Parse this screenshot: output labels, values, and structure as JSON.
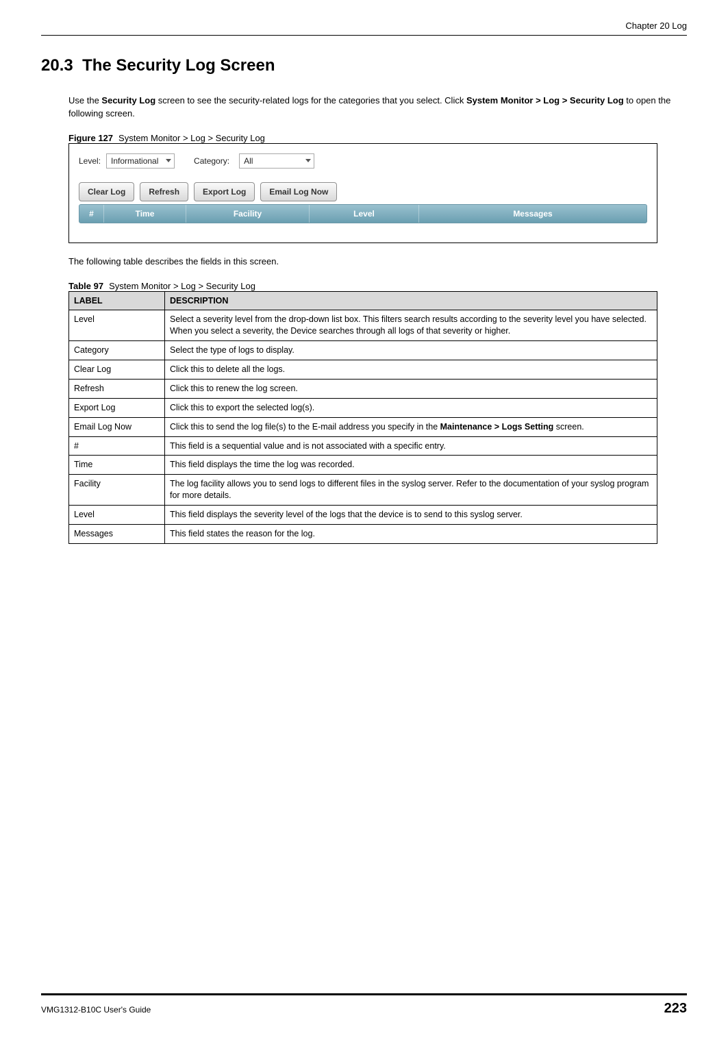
{
  "header": {
    "chapter": "Chapter 20 Log"
  },
  "section": {
    "number": "20.3",
    "title": "The Security Log Screen"
  },
  "intro": {
    "prefix": "Use the ",
    "bold1": "Security Log",
    "mid1": " screen to see the security-related logs for the categories that you select. Click ",
    "bold2": "System Monitor > Log > Security Log",
    "suffix": " to open the following screen."
  },
  "figure": {
    "label": "Figure 127",
    "caption": "System Monitor > Log > Security Log",
    "filters": {
      "level_label": "Level:",
      "level_value": "Informational",
      "category_label": "Category:",
      "category_value": "All"
    },
    "buttons": {
      "clear": "Clear Log",
      "refresh": "Refresh",
      "export": "Export Log",
      "email": "Email Log Now"
    },
    "columns": {
      "num": "#",
      "time": "Time",
      "facility": "Facility",
      "level": "Level",
      "messages": "Messages"
    }
  },
  "post_figure_text": "The following table describes the fields in this screen.",
  "table": {
    "label": "Table 97",
    "caption": "System Monitor > Log > Security Log",
    "header": {
      "label": "LABEL",
      "description": "DESCRIPTION"
    },
    "rows": [
      {
        "label": "Level",
        "desc": "Select a severity level from the drop-down list box. This filters search results according to the severity level you have selected. When you select a severity, the Device searches through all logs of that severity or higher."
      },
      {
        "label": "Category",
        "desc": "Select the type of logs to display."
      },
      {
        "label": "Clear Log",
        "desc": "Click this to delete all the logs."
      },
      {
        "label": "Refresh",
        "desc": "Click this to renew the log screen."
      },
      {
        "label": "Export Log",
        "desc": "Click this to export the selected log(s)."
      },
      {
        "label": "Email Log Now",
        "desc_pre": "Click this to send the log file(s) to the E-mail address you specify in the ",
        "desc_bold": "Maintenance > Logs Setting",
        "desc_post": " screen."
      },
      {
        "label": "#",
        "desc": "This field is a sequential value and is not associated with a specific entry."
      },
      {
        "label": "Time",
        "desc": "This field displays the time the log was recorded."
      },
      {
        "label": "Facility",
        "desc": "The log facility allows you to send logs to different files in the syslog server. Refer to the documentation of your syslog program for more details."
      },
      {
        "label": "Level",
        "desc": "This field displays the severity level of the logs that the device is to send to this syslog server."
      },
      {
        "label": "Messages",
        "desc": "This field states the reason for the log."
      }
    ]
  },
  "footer": {
    "guide": "VMG1312-B10C User's Guide",
    "page": "223"
  }
}
